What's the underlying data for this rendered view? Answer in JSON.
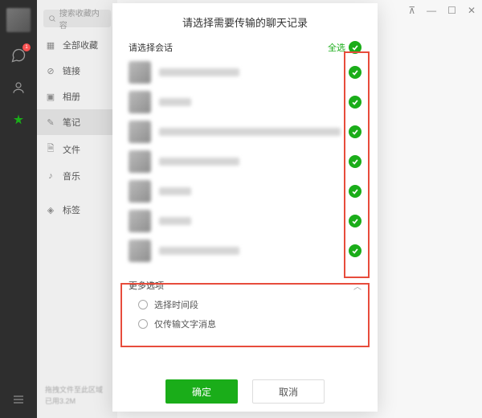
{
  "rail": {
    "badge": "1"
  },
  "sidebar": {
    "search_placeholder": "搜索收藏内容",
    "items": [
      {
        "label": "全部收藏"
      },
      {
        "label": "链接"
      },
      {
        "label": "相册"
      },
      {
        "label": "笔记"
      },
      {
        "label": "文件"
      },
      {
        "label": "音乐"
      },
      {
        "label": "标签"
      }
    ],
    "footer_line1": "拖拽文件至此区域",
    "footer_line2": "已用3.2M"
  },
  "dialog": {
    "title": "请选择需要传输的聊天记录",
    "select_label": "请选择会话",
    "select_all": "全选",
    "more_label": "更多选项",
    "option_time": "选择时间段",
    "option_textonly": "仅传输文字消息",
    "ok": "确定",
    "cancel": "取消"
  }
}
